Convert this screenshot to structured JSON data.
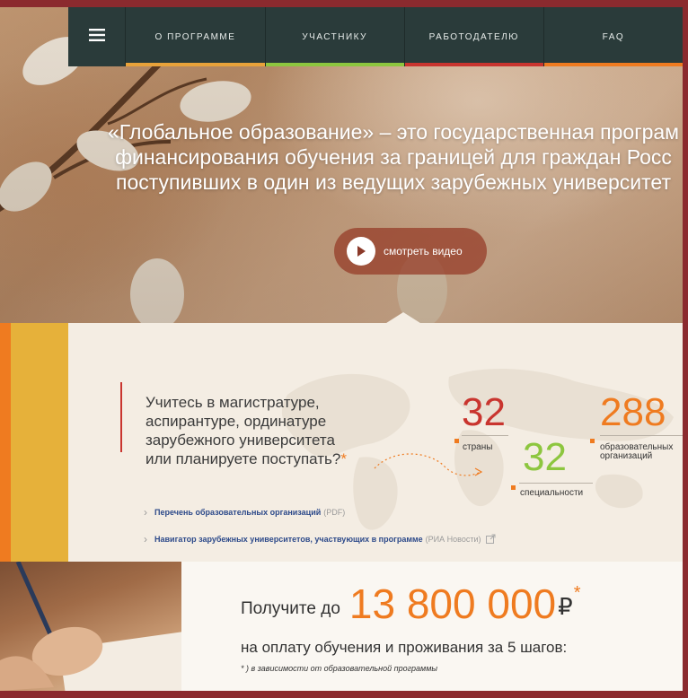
{
  "nav": {
    "items": [
      {
        "label": "О ПРОГРАММЕ",
        "color": "#e8a23a"
      },
      {
        "label": "УЧАСТНИКУ",
        "color": "#8dc63f"
      },
      {
        "label": "РАБОТОДАТЕЛЮ",
        "color": "#c9352f"
      },
      {
        "label": "FAQ",
        "color": "#ef7b20"
      }
    ],
    "menu_icon": "hamburger-icon"
  },
  "hero": {
    "lines": [
      "«Глобальное образование» – это государственная програм",
      "финансирования обучения за границей для граждан Росс",
      "поступивших в один из ведущих зарубежных университет"
    ],
    "video_button_label": "смотреть видео",
    "video_icon": "play-icon"
  },
  "intro": {
    "question_lines": [
      "Учитесь в магистратуре,",
      "аспирантуре, ординатуре",
      "зарубежного университета",
      "или планируете поступать?"
    ],
    "asterisk": "*"
  },
  "stats": [
    {
      "value": "32",
      "label": "страны",
      "color": "#c9352f"
    },
    {
      "value": "288",
      "label_lines": [
        "образовательных",
        "организаций"
      ],
      "color": "#ef7b20"
    },
    {
      "value": "32",
      "label": "специальности",
      "color": "#8dc63f"
    }
  ],
  "links": [
    {
      "text": "Перечень образовательных организаций",
      "note": "(PDF)"
    },
    {
      "text": "Навигатор зарубежных университетов, участвующих в программе",
      "note": "(РИА Новости)"
    }
  ],
  "offer": {
    "prefix": "Получите до",
    "amount": "13 800 000",
    "currency": "₽",
    "star": "*",
    "line2": "на оплату обучения и проживания за 5 шагов:",
    "note": "* ) в зависимости от образовательной программы"
  },
  "colors": {
    "accent_orange": "#ef7b20",
    "accent_red": "#c9352f",
    "accent_green": "#8dc63f",
    "accent_yellow": "#e6b13a",
    "nav_bg": "#2a3b3a",
    "frame": "#8b2a2e"
  }
}
